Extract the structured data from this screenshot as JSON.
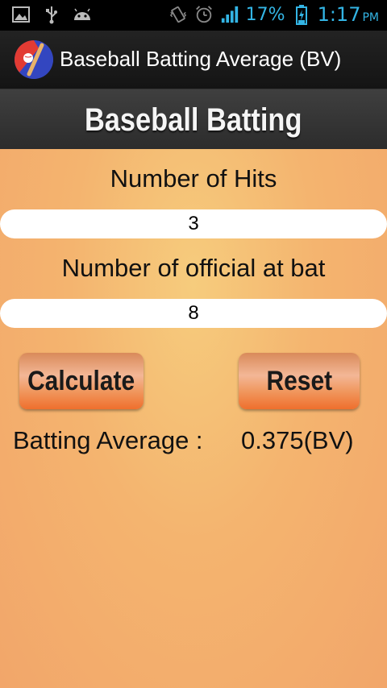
{
  "status_bar": {
    "battery": "17%",
    "time": "1:17",
    "ampm": "PM",
    "icons_left": [
      "image-icon",
      "usb-icon",
      "android-icon"
    ],
    "icons_right": [
      "vibrate-icon",
      "alarm-icon",
      "signal-icon",
      "battery-icon"
    ],
    "color": "#33b5e5"
  },
  "action_bar": {
    "title": "Baseball Batting Average (BV)"
  },
  "banner": {
    "title": "Baseball Batting"
  },
  "form": {
    "hits_label": "Number of Hits",
    "hits_value": "3",
    "at_bat_label": "Number of official at bat",
    "at_bat_value": "8"
  },
  "buttons": {
    "calculate": "Calculate",
    "reset": "Reset"
  },
  "result": {
    "label": "Batting Average :",
    "value": "0.375(BV)"
  },
  "colors": {
    "background": "#f4b46f",
    "button": "#f0955b"
  }
}
